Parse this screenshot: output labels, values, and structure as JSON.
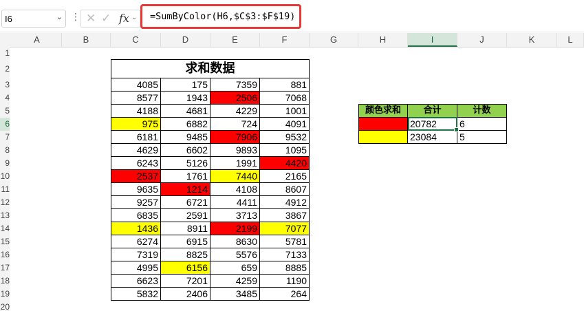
{
  "namebox": {
    "value": "I6"
  },
  "formula_bar": {
    "fx_label": "fx",
    "cancel_icon": "close-icon",
    "enter_icon": "check-icon",
    "formula": "=SumByColor(H6,$C$3:$F$19)"
  },
  "columns": [
    "A",
    "B",
    "C",
    "D",
    "E",
    "F",
    "G",
    "H",
    "I",
    "J",
    "K",
    "L"
  ],
  "rows": [
    "1",
    "2",
    "3",
    "4",
    "5",
    "6",
    "7",
    "8",
    "9",
    "10",
    "11",
    "12",
    "13",
    "14",
    "15",
    "16",
    "17",
    "18",
    "19",
    "20"
  ],
  "active_cell": {
    "column": "I",
    "row": "6"
  },
  "colors": {
    "red": "#ff0000",
    "yellow": "#ffff00",
    "header_green": "#92d050",
    "selection": "#217346",
    "formula_highlight": "#e53935"
  },
  "data_table": {
    "title": "求和数据",
    "rows": [
      [
        {
          "v": "4085"
        },
        {
          "v": "175"
        },
        {
          "v": "7359"
        },
        {
          "v": "881"
        }
      ],
      [
        {
          "v": "8577"
        },
        {
          "v": "1943"
        },
        {
          "v": "2506",
          "c": "red"
        },
        {
          "v": "7068"
        }
      ],
      [
        {
          "v": "4188"
        },
        {
          "v": "4681"
        },
        {
          "v": "4229"
        },
        {
          "v": "1001"
        }
      ],
      [
        {
          "v": "975",
          "c": "yellow"
        },
        {
          "v": "6882"
        },
        {
          "v": "724"
        },
        {
          "v": "4091"
        }
      ],
      [
        {
          "v": "6181"
        },
        {
          "v": "9485"
        },
        {
          "v": "7906",
          "c": "red"
        },
        {
          "v": "9532"
        }
      ],
      [
        {
          "v": "4629"
        },
        {
          "v": "6602"
        },
        {
          "v": "9893"
        },
        {
          "v": "1095"
        }
      ],
      [
        {
          "v": "6243"
        },
        {
          "v": "5126"
        },
        {
          "v": "1991"
        },
        {
          "v": "4420",
          "c": "red"
        }
      ],
      [
        {
          "v": "2537",
          "c": "red"
        },
        {
          "v": "1761"
        },
        {
          "v": "7440",
          "c": "yellow"
        },
        {
          "v": "2165"
        }
      ],
      [
        {
          "v": "9635"
        },
        {
          "v": "1214",
          "c": "red"
        },
        {
          "v": "4108"
        },
        {
          "v": "8607"
        }
      ],
      [
        {
          "v": "9257"
        },
        {
          "v": "6721"
        },
        {
          "v": "4411"
        },
        {
          "v": "4912"
        }
      ],
      [
        {
          "v": "6835"
        },
        {
          "v": "2591"
        },
        {
          "v": "3713"
        },
        {
          "v": "3867"
        }
      ],
      [
        {
          "v": "1436",
          "c": "yellow"
        },
        {
          "v": "8911"
        },
        {
          "v": "2199",
          "c": "red"
        },
        {
          "v": "7077",
          "c": "yellow"
        }
      ],
      [
        {
          "v": "6274"
        },
        {
          "v": "6915"
        },
        {
          "v": "8630"
        },
        {
          "v": "5781"
        }
      ],
      [
        {
          "v": "7319"
        },
        {
          "v": "8825"
        },
        {
          "v": "5576"
        },
        {
          "v": "7133"
        }
      ],
      [
        {
          "v": "4995"
        },
        {
          "v": "6156",
          "c": "yellow"
        },
        {
          "v": "659"
        },
        {
          "v": "8885"
        }
      ],
      [
        {
          "v": "6623"
        },
        {
          "v": "7201"
        },
        {
          "v": "4259"
        },
        {
          "v": "1190"
        }
      ],
      [
        {
          "v": "5832"
        },
        {
          "v": "2406"
        },
        {
          "v": "3485"
        },
        {
          "v": "264"
        }
      ]
    ]
  },
  "summary_table": {
    "headers": [
      "颜色求和",
      "合计",
      "计数"
    ],
    "rows": [
      {
        "color": "red",
        "sum": "20782",
        "count": "6"
      },
      {
        "color": "yellow",
        "sum": "23084",
        "count": "5"
      }
    ]
  }
}
